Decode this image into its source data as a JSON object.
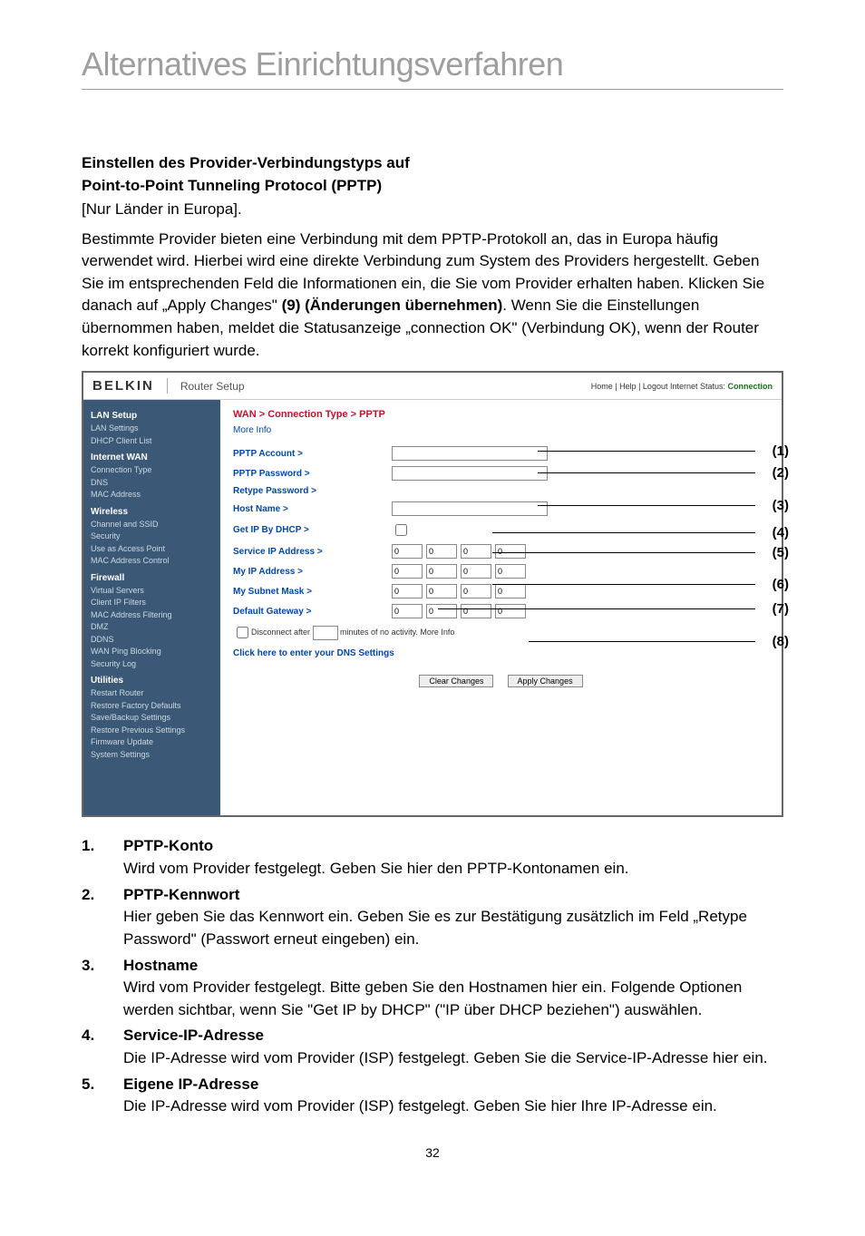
{
  "page": {
    "title": "Alternatives Einrichtungsverfahren",
    "number": "32"
  },
  "section": {
    "heading_l1": "Einstellen des Provider-Verbindungstyps auf",
    "heading_l2": "Point-to-Point Tunneling Protocol (PPTP)",
    "sub": "[Nur Länder in Europa].",
    "para_a": "Bestimmte Provider bieten eine Verbindung mit dem PPTP-Protokoll an, das in Europa häufig verwendet wird. Hierbei wird eine direkte Verbindung zum System des Providers hergestellt. Geben Sie im entsprechenden Feld die Informationen ein, die Sie vom Provider erhalten haben. Klicken Sie danach auf „Apply Changes\" ",
    "para_bold": "(9) (Änderungen übernehmen)",
    "para_b": ". Wenn Sie die Einstellungen übernommen haben, meldet die Statusanzeige „connection OK\" (Verbindung OK), wenn der Router korrekt konfiguriert wurde."
  },
  "ss": {
    "logo": "BELKIN",
    "title": "Router Setup",
    "top_links": "Home | Help | Logout   Internet Status: ",
    "top_conn": "Connection",
    "crumb": "WAN > Connection Type > PPTP",
    "moreinfo": "More Info",
    "sidebar": {
      "c1": "LAN Setup",
      "i1a": "LAN Settings",
      "i1b": "DHCP Client List",
      "c2": "Internet WAN",
      "i2a": "Connection Type",
      "i2b": "DNS",
      "i2c": "MAC Address",
      "c3": "Wireless",
      "i3a": "Channel and SSID",
      "i3b": "Security",
      "i3c": "Use as Access Point",
      "i3d": "MAC Address Control",
      "c4": "Firewall",
      "i4a": "Virtual Servers",
      "i4b": "Client IP Filters",
      "i4c": "MAC Address Filtering",
      "i4d": "DMZ",
      "i4e": "DDNS",
      "i4f": "WAN Ping Blocking",
      "i4g": "Security Log",
      "c5": "Utilities",
      "i5a": "Restart Router",
      "i5b": "Restore Factory Defaults",
      "i5c": "Save/Backup Settings",
      "i5d": "Restore Previous Settings",
      "i5e": "Firmware Update",
      "i5f": "System Settings"
    },
    "labels": {
      "l1": "PPTP Account >",
      "l2": "PPTP Password >",
      "l3": "Retype Password >",
      "l4": "Host Name >",
      "l5": "Get IP By DHCP >",
      "l6": "Service IP Address >",
      "l7": "My IP Address >",
      "l8": "My Subnet Mask >",
      "l9": "Default Gateway >"
    },
    "ip": {
      "a": "0",
      "b": "0",
      "c": "0",
      "d": "0"
    },
    "disc_a": "Disconnect after ",
    "disc_b": " minutes of no activity. More Info",
    "click_dns": "Click here to enter your DNS Settings",
    "btn_clear": "Clear Changes",
    "btn_apply": "Apply Changes",
    "annot": {
      "a1": "(1)",
      "a2": "(2)",
      "a3": "(3)",
      "a4": "(4)",
      "a5": "(5)",
      "a6": "(6)",
      "a7": "(7)",
      "a8": "(8)"
    }
  },
  "list": {
    "n1": "1.",
    "t1": "PPTP-Konto",
    "d1": "Wird vom Provider festgelegt. Geben Sie hier den PPTP-Kontonamen ein.",
    "n2": "2.",
    "t2": "PPTP-Kennwort",
    "d2": "Hier geben Sie das Kennwort ein. Geben Sie es zur Bestätigung zusätzlich im Feld „Retype Password\" (Passwort erneut eingeben) ein.",
    "n3": "3.",
    "t3": "Hostname",
    "d3": "Wird vom Provider festgelegt. Bitte geben Sie den Hostnamen hier ein. Folgende Optionen werden sichtbar, wenn Sie \"Get IP by DHCP\" (\"IP über DHCP beziehen\") auswählen.",
    "n4": "4.",
    "t4": "Service-IP-Adresse",
    "d4": "Die IP-Adresse wird vom Provider (ISP) festgelegt. Geben Sie die Service-IP-Adresse hier ein.",
    "n5": "5.",
    "t5": "Eigene IP-Adresse",
    "d5": "Die IP-Adresse wird vom Provider (ISP) festgelegt. Geben Sie hier Ihre IP-Adresse ein."
  }
}
